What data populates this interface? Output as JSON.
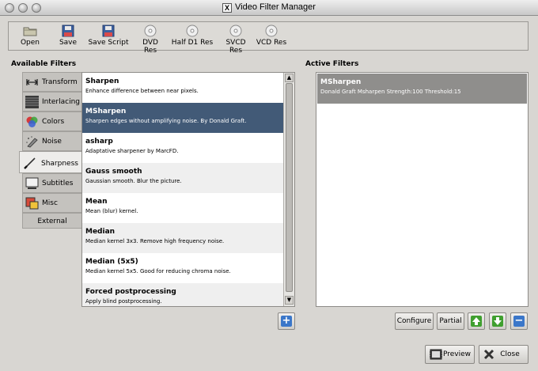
{
  "window": {
    "title": "Video Filter Manager",
    "title_icon": "x11-icon"
  },
  "toolbar": [
    {
      "label": "Open",
      "icon": "folder-icon"
    },
    {
      "label": "Save",
      "icon": "floppy-icon"
    },
    {
      "label": "Save Script",
      "icon": "floppy-script-icon"
    },
    {
      "label": "DVD Res",
      "icon": "disc-icon"
    },
    {
      "label": "Half D1 Res",
      "icon": "disc-icon"
    },
    {
      "label": "SVCD Res",
      "icon": "disc-icon"
    },
    {
      "label": "VCD Res",
      "icon": "disc-icon"
    }
  ],
  "available": {
    "heading": "Available Filters",
    "categories": [
      {
        "label": "Transform",
        "icon": "transform-icon"
      },
      {
        "label": "Interlacing",
        "icon": "interlacing-icon"
      },
      {
        "label": "Colors",
        "icon": "colors-icon"
      },
      {
        "label": "Noise",
        "icon": "noise-icon"
      },
      {
        "label": "Sharpness",
        "icon": "sharpness-icon"
      },
      {
        "label": "Subtitles",
        "icon": "subtitles-icon"
      },
      {
        "label": "Misc",
        "icon": "misc-icon"
      },
      {
        "label": "External",
        "icon": ""
      }
    ],
    "selected_category": "Sharpness",
    "filters": [
      {
        "name": "Sharpen",
        "desc": "Enhance difference between near pixels."
      },
      {
        "name": "MSharpen",
        "desc": "Sharpen edges without amplifying noise. By Donald Graft."
      },
      {
        "name": "asharp",
        "desc": "Adaptative sharpener by MarcFD."
      },
      {
        "name": "Gauss smooth",
        "desc": "Gaussian smooth. Blur the picture."
      },
      {
        "name": "Mean",
        "desc": "Mean (blur) kernel."
      },
      {
        "name": "Median",
        "desc": "Median kernel 3x3. Remove high frequency noise."
      },
      {
        "name": "Median (5x5)",
        "desc": "Median kernel 5x5. Good for reducing chroma noise."
      },
      {
        "name": "Forced postprocessing",
        "desc": "Apply blind postprocessing."
      }
    ],
    "selected_filter": "MSharpen",
    "add_icon": "plus-icon"
  },
  "active": {
    "heading": "Active Filters",
    "items": [
      {
        "name": "MSharpen",
        "desc": "Donald Graft Msharpen Strength:100 Threshold:15"
      }
    ]
  },
  "buttons": {
    "configure": "Configure",
    "partial": "Partial",
    "preview": "Preview",
    "close": "Close"
  },
  "colors": {
    "selection": "#425a77",
    "active_selection": "#8f8e8c",
    "accent_green": "#3f9f2f",
    "accent_blue": "#3b77c9"
  }
}
